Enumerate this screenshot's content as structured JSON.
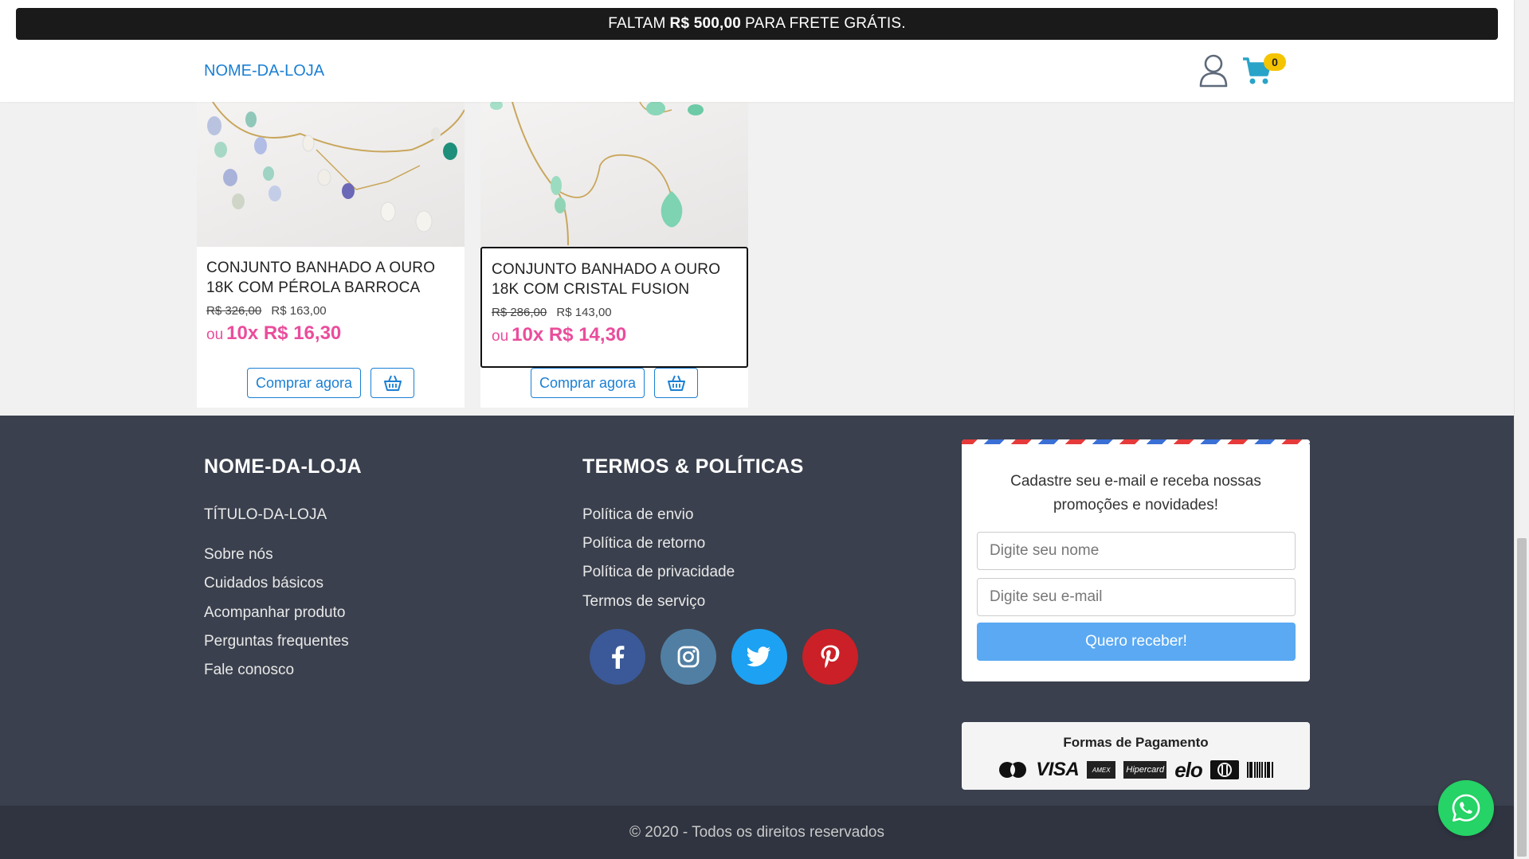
{
  "promo": {
    "prefix": "FALTAM",
    "amount": "R$ 500,00",
    "suffix": "PARA FRETE GRÁTIS."
  },
  "header": {
    "store_name": "NOME-DA-LOJA",
    "cart_count": "0"
  },
  "products": [
    {
      "title": "CONJUNTO BANHADO A OURO 18K COM PÉROLA BARROCA",
      "old_price": "R$ 326,00",
      "price": "R$ 163,00",
      "installment_prefix": "ou",
      "installment": "10x R$ 16,30",
      "buy_label": "Comprar agora"
    },
    {
      "title": "CONJUNTO BANHADO A OURO 18K COM CRISTAL FUSION",
      "old_price": "R$ 286,00",
      "price": "R$ 143,00",
      "installment_prefix": "ou",
      "installment": "10x R$ 14,30",
      "buy_label": "Comprar agora"
    }
  ],
  "footer": {
    "store": {
      "title": "NOME-DA-LOJA",
      "subtitle": "TÍTULO-DA-LOJA",
      "links": [
        "Sobre nós",
        "Cuidados básicos",
        "Acompanhar produto",
        "Perguntas frequentes",
        "Fale conosco"
      ]
    },
    "policies": {
      "title": "TERMOS & POLÍTICAS",
      "links": [
        "Política de envio",
        "Política de retorno",
        "Política de privacidade",
        "Termos de serviço"
      ]
    },
    "social": [
      {
        "name": "facebook-icon",
        "color": "#3b5998"
      },
      {
        "name": "instagram-icon",
        "color": "#517fa4"
      },
      {
        "name": "twitter-icon",
        "color": "#1da1f2"
      },
      {
        "name": "pinterest-icon",
        "color": "#cb2027"
      }
    ],
    "newsletter": {
      "text": "Cadastre seu e-mail e receba nossas promoções e novidades!",
      "name_placeholder": "Digite seu nome",
      "email_placeholder": "Digite seu e-mail",
      "submit_label": "Quero receber!"
    },
    "payments": {
      "title": "Formas de Pagamento",
      "visa": "VISA",
      "amex": "AMEX",
      "hipercard": "Hipercard",
      "elo": "elo"
    },
    "copyright": "© 2020 - Todos os direitos reservados"
  },
  "colors": {
    "link": "#1a7fd3",
    "pink": "#ea4d9c",
    "footer_bg": "#3a404d",
    "submit": "#5aa9f2",
    "whatsapp": "#25d366",
    "badge": "#f5c400"
  }
}
